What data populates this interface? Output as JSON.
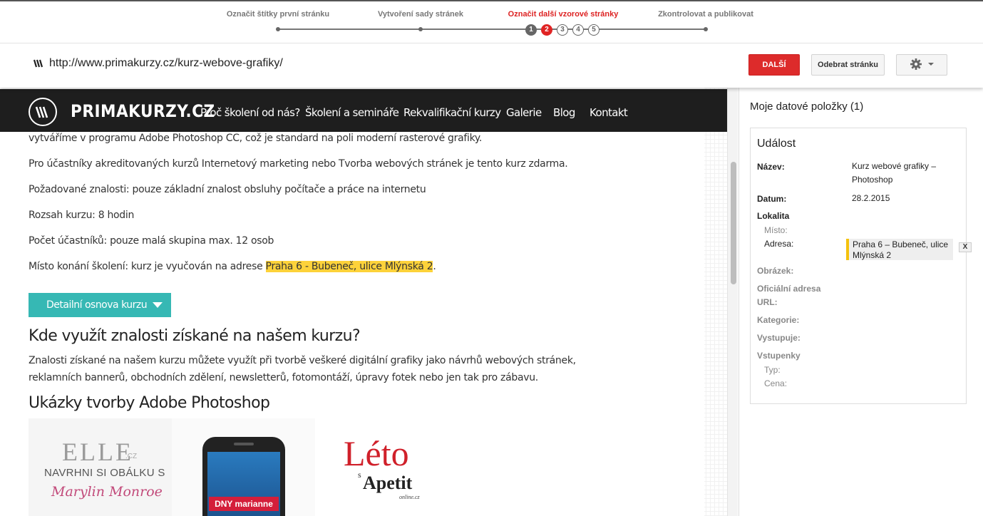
{
  "steps": [
    {
      "label": "Označit štítky první stránku",
      "state": "done"
    },
    {
      "label": "Vytvoření sady stránek",
      "state": "done"
    },
    {
      "label": "Označit další vzorové stránky",
      "state": "active"
    },
    {
      "label": "Zkontrolovat a publikovat",
      "state": "todo"
    }
  ],
  "substeps": [
    "1",
    "2",
    "3",
    "4",
    "5"
  ],
  "url": "http://www.primakurzy.cz/kurz-webove-grafiky/",
  "buttons": {
    "next": "DALŠÍ",
    "remove": "Odebrat stránku",
    "gear_icon": "gear-icon"
  },
  "site": {
    "logo": "PRIMAKURZY.CZ",
    "nav": [
      "Proč školení od nás?",
      "Školení a semináře",
      "Rekvalifikační kurzy",
      "Galerie",
      "Blog",
      "Kontakt"
    ]
  },
  "content": {
    "p0": "vytváříme v programu Adobe Photoshop CC, což je standard na poli moderní rasterové grafiky.",
    "p1": "Pro účastníky akreditovaných kurzů Internetový marketing nebo Tvorba webových stránek je tento kurz zdarma.",
    "p2": "Požadované znalosti: pouze základní znalost obsluhy počítače a práce na internetu",
    "p3": "Rozsah kurzu: 8 hodin",
    "p4": "Počet účastníků: pouze malá skupina max. 12 osob",
    "p5_prefix": "Místo konání školení: kurz je vyučován na adrese ",
    "p5_highlight": "Praha 6 - Bubeneč, ulice Mlýnská 2",
    "p5_suffix": ".",
    "outline_button": "Detailní osnova kurzu",
    "h_use": "Kde využít znalosti získané na našem kurzu?",
    "use_line1": "Znalosti získané na našem kurzu můžete využít při tvorbě veškeré digitální grafiky jako návrhů webových stránek,",
    "use_line2": "reklamních bannerů, obchodních zdělení, newsletterů, fotomontáží, úpravy fotek nebo jen tak pro zábavu.",
    "h_samples": "Ukázky tvorby Adobe Photoshop",
    "gallery": {
      "elle": "ELLE",
      "elle_cz": ".CZ",
      "elle_sub": "NAVRHNI SI OBÁLKU S",
      "elle_script": "Marylin Monroe",
      "phone": "DNY marianne",
      "leto": "Léto",
      "leto_s": "s",
      "apetit": "Apetit",
      "online": "online.cz"
    }
  },
  "panel": {
    "title": "Moje datové položky (1)",
    "card_title": "Událost",
    "labels": {
      "nazev": "Název:",
      "datum": "Datum:",
      "lokalita": "Lokalita",
      "misto": "Místo:",
      "adresa": "Adresa:",
      "obrazek": "Obrázek:",
      "oficialni": "Oficiální adresa",
      "url": "URL:",
      "kategorie": "Kategorie:",
      "vystupuje": "Vystupuje:",
      "vstupenky": "Vstupenky",
      "typ": "Typ:",
      "cena": "Cena:"
    },
    "values": {
      "nazev": "Kurz webové grafiky – Photoshop",
      "datum": "28.2.2015",
      "adresa": "Praha 6 – Bubeneč, ulice Mlýnská 2"
    },
    "remove_x": "X"
  },
  "colors": {
    "accent_red": "#dd2b2b",
    "teal": "#36b8b4",
    "highlight": "#fdd23a",
    "address_marker": "#f4c20d"
  }
}
